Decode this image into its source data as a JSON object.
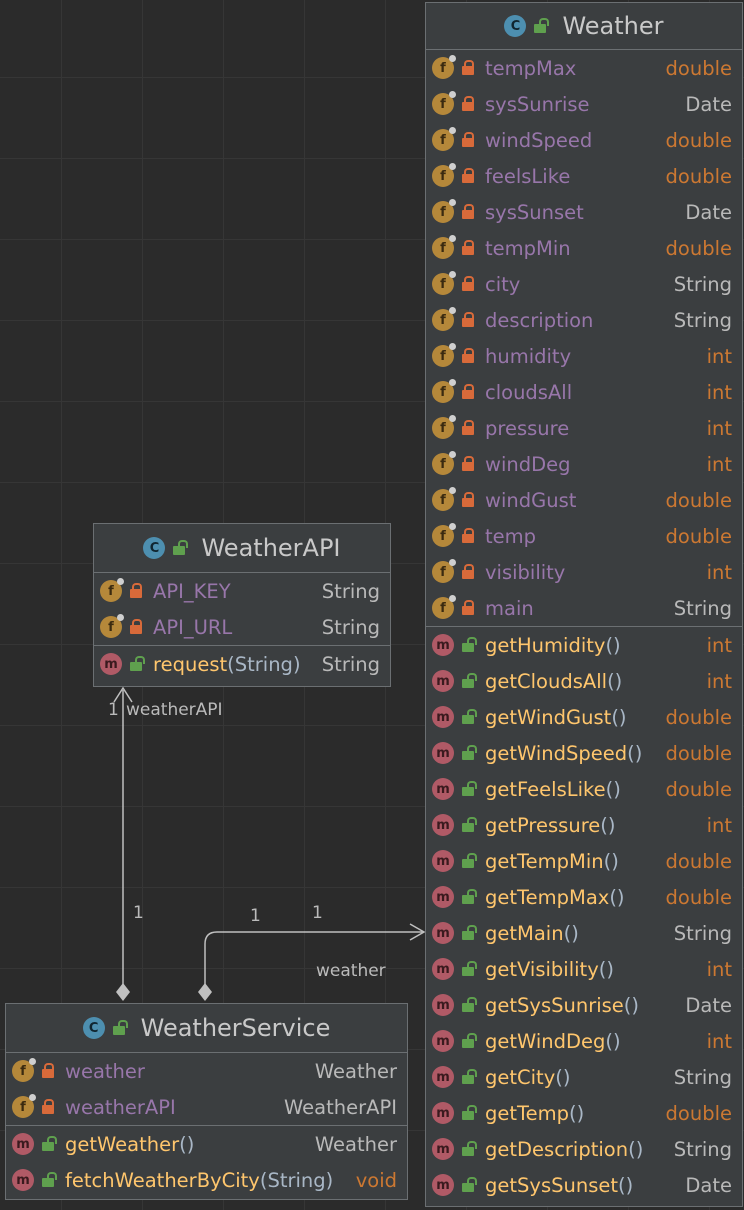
{
  "classes": {
    "weather": {
      "kind_icon": "C",
      "title": "Weather",
      "fields": [
        {
          "name": "tempMax",
          "type": "double",
          "kw": true
        },
        {
          "name": "sysSunrise",
          "type": "Date",
          "kw": false
        },
        {
          "name": "windSpeed",
          "type": "double",
          "kw": true
        },
        {
          "name": "feelsLike",
          "type": "double",
          "kw": true
        },
        {
          "name": "sysSunset",
          "type": "Date",
          "kw": false
        },
        {
          "name": "tempMin",
          "type": "double",
          "kw": true
        },
        {
          "name": "city",
          "type": "String",
          "kw": false
        },
        {
          "name": "description",
          "type": "String",
          "kw": false
        },
        {
          "name": "humidity",
          "type": "int",
          "kw": true
        },
        {
          "name": "cloudsAll",
          "type": "int",
          "kw": true
        },
        {
          "name": "pressure",
          "type": "int",
          "kw": true
        },
        {
          "name": "windDeg",
          "type": "int",
          "kw": true
        },
        {
          "name": "windGust",
          "type": "double",
          "kw": true
        },
        {
          "name": "temp",
          "type": "double",
          "kw": true
        },
        {
          "name": "visibility",
          "type": "int",
          "kw": true
        },
        {
          "name": "main",
          "type": "String",
          "kw": false
        }
      ],
      "methods": [
        {
          "name": "getHumidity",
          "params": "",
          "type": "int",
          "kw": true
        },
        {
          "name": "getCloudsAll",
          "params": "",
          "type": "int",
          "kw": true
        },
        {
          "name": "getWindGust",
          "params": "",
          "type": "double",
          "kw": true
        },
        {
          "name": "getWindSpeed",
          "params": "",
          "type": "double",
          "kw": true
        },
        {
          "name": "getFeelsLike",
          "params": "",
          "type": "double",
          "kw": true
        },
        {
          "name": "getPressure",
          "params": "",
          "type": "int",
          "kw": true
        },
        {
          "name": "getTempMin",
          "params": "",
          "type": "double",
          "kw": true
        },
        {
          "name": "getTempMax",
          "params": "",
          "type": "double",
          "kw": true
        },
        {
          "name": "getMain",
          "params": "",
          "type": "String",
          "kw": false
        },
        {
          "name": "getVisibility",
          "params": "",
          "type": "int",
          "kw": true
        },
        {
          "name": "getSysSunrise",
          "params": "",
          "type": "Date",
          "kw": false
        },
        {
          "name": "getWindDeg",
          "params": "",
          "type": "int",
          "kw": true
        },
        {
          "name": "getCity",
          "params": "",
          "type": "String",
          "kw": false
        },
        {
          "name": "getTemp",
          "params": "",
          "type": "double",
          "kw": true
        },
        {
          "name": "getDescription",
          "params": "",
          "type": "String",
          "kw": false
        },
        {
          "name": "getSysSunset",
          "params": "",
          "type": "Date",
          "kw": false
        }
      ]
    },
    "weatherapi": {
      "kind_icon": "C",
      "title": "WeatherAPI",
      "fields": [
        {
          "name": "API_KEY",
          "type": "String",
          "kw": false
        },
        {
          "name": "API_URL",
          "type": "String",
          "kw": false
        }
      ],
      "methods": [
        {
          "name": "request",
          "params": "String",
          "type": "String",
          "kw": false
        }
      ]
    },
    "weatherservice": {
      "kind_icon": "C",
      "title": "WeatherService",
      "fields": [
        {
          "name": "weather",
          "type": "Weather",
          "kw": false
        },
        {
          "name": "weatherAPI",
          "type": "WeatherAPI",
          "kw": false
        }
      ],
      "methods": [
        {
          "name": "getWeather",
          "params": "",
          "type": "Weather",
          "kw": false
        },
        {
          "name": "fetchWeatherByCity",
          "params": "String",
          "type": "void",
          "kw": true
        }
      ]
    }
  },
  "edges": {
    "service_to_api": {
      "target_mult": "1",
      "role": "weatherAPI",
      "source_mult": "1"
    },
    "service_to_weather": {
      "source_mult": "1",
      "target_mult": "1",
      "role": "weather"
    }
  },
  "icons": {
    "field": "f",
    "method": "m",
    "private_visibility": "lock-icon",
    "public_visibility": "unlocked-icon"
  },
  "colors": {
    "background": "#2b2b2b",
    "box": "#3b3e40",
    "field_name": "#9876aa",
    "method_name": "#ffc66d",
    "keyword_type": "#cc7832",
    "field_badge": "#b5883a",
    "method_badge": "#b05a66",
    "class_badge": "#4d8fb0"
  }
}
